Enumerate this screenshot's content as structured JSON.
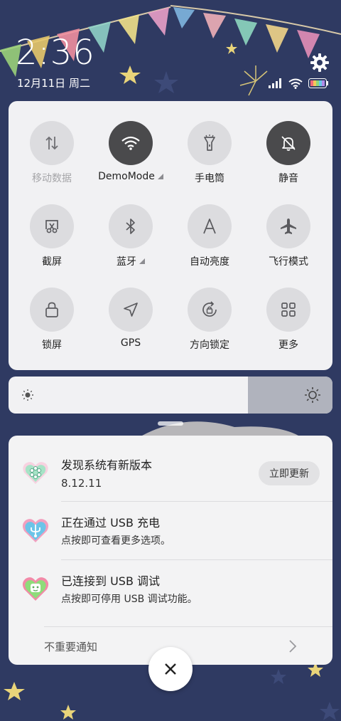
{
  "status_bar": {
    "time": "2:36",
    "date": "12月11日 周二"
  },
  "quick_settings": {
    "tiles": [
      {
        "label": "移动数据",
        "icon": "mobile-data-icon",
        "state": "disabled"
      },
      {
        "label": "DemoMode",
        "icon": "wifi-icon",
        "state": "on",
        "expandable": true
      },
      {
        "label": "手电筒",
        "icon": "flashlight-icon",
        "state": "off"
      },
      {
        "label": "静音",
        "icon": "mute-bell-icon",
        "state": "on"
      },
      {
        "label": "截屏",
        "icon": "screenshot-icon",
        "state": "off"
      },
      {
        "label": "蓝牙",
        "icon": "bluetooth-icon",
        "state": "off",
        "expandable": true
      },
      {
        "label": "自动亮度",
        "icon": "auto-brightness-icon",
        "state": "off"
      },
      {
        "label": "飞行模式",
        "icon": "airplane-icon",
        "state": "off"
      },
      {
        "label": "锁屏",
        "icon": "lock-icon",
        "state": "off"
      },
      {
        "label": "GPS",
        "icon": "gps-icon",
        "state": "off"
      },
      {
        "label": "方向锁定",
        "icon": "rotation-lock-icon",
        "state": "off"
      },
      {
        "label": "更多",
        "icon": "more-grid-icon",
        "state": "off"
      }
    ],
    "brightness_level": 0.74
  },
  "notifications": [
    {
      "title": "发现系统有新版本",
      "text": "8.12.11",
      "action": "立即更新",
      "icon": "system-update-app-icon"
    },
    {
      "title": "正在通过 USB 充电",
      "text": "点按即可查看更多选项。",
      "icon": "usb-charging-app-icon"
    },
    {
      "title": "已连接到 USB 调试",
      "text": "点按即可停用 USB 调试功能。",
      "icon": "usb-debug-app-icon"
    }
  ],
  "unimportant_label": "不重要通知",
  "colors": {
    "wallpaper": "#2f3a62",
    "panel": "#f1f1f3",
    "tile_off": "#dcdcdf",
    "tile_on": "#4a4a4c"
  }
}
